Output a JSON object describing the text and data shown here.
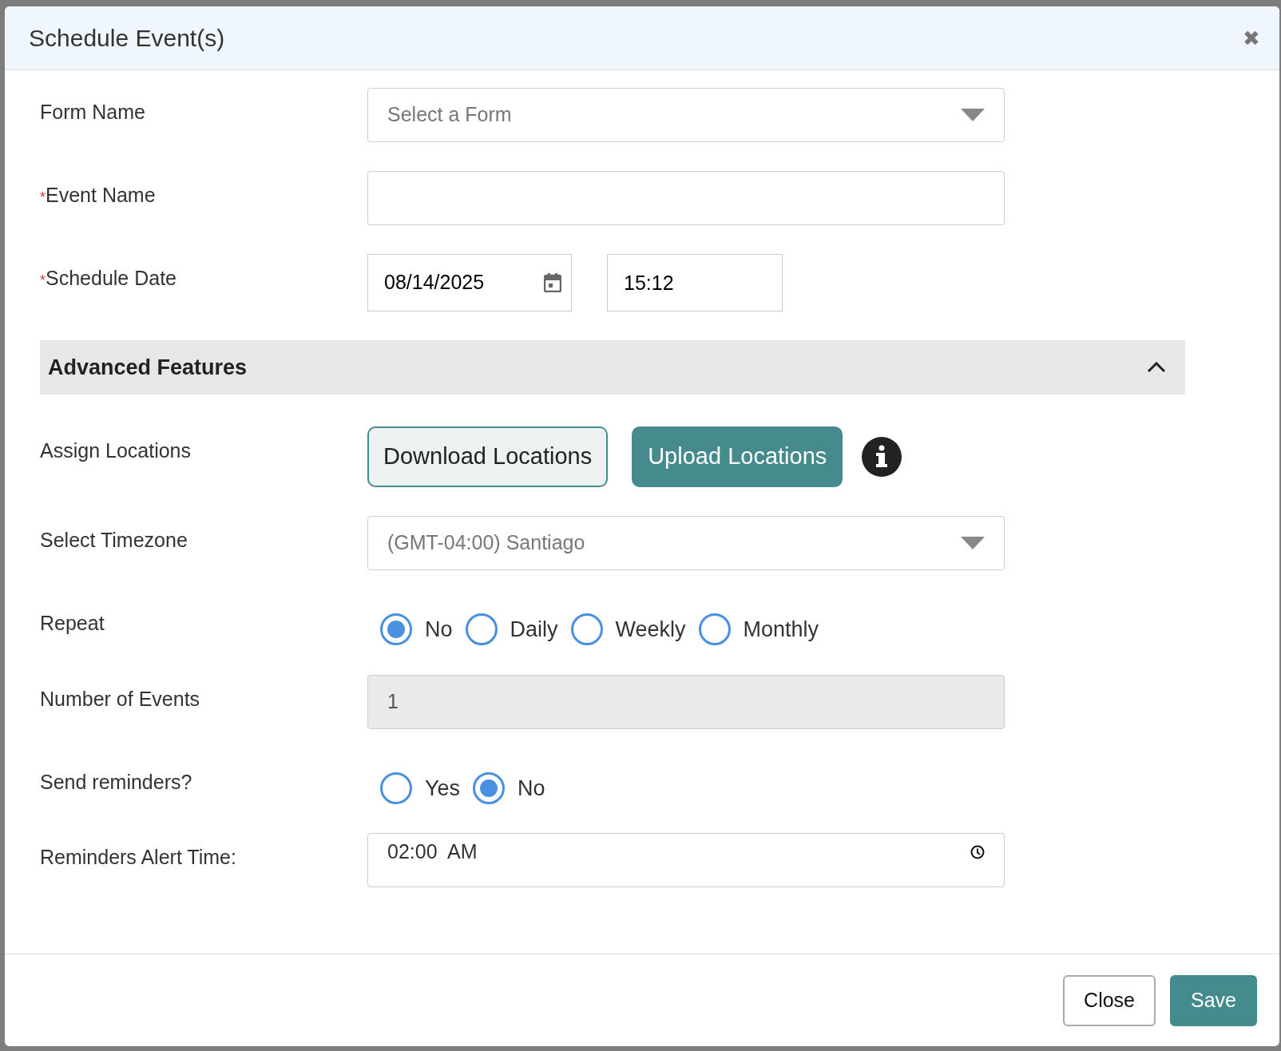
{
  "modal": {
    "title": "Schedule Event(s)",
    "close_icon": "✖"
  },
  "fields": [
    {
      "kind": "select",
      "label": "Form Name",
      "placeholder": "Select a Form"
    },
    {
      "kind": "text",
      "label": "Event Name",
      "required_mark": "*"
    },
    {
      "kind": "datetime",
      "label": "Schedule Date",
      "required_mark": "*",
      "date": "08/14/2025",
      "time": "15:12"
    }
  ],
  "advanced": {
    "title": "Advanced Features",
    "expanded": true,
    "fields": [
      {
        "kind": "buttons",
        "label": "Assign Locations",
        "buttons": [
          {
            "label": "Download Locations",
            "primary": false
          },
          {
            "label": "Upload Locations",
            "primary": true
          }
        ]
      },
      {
        "kind": "select",
        "label": "Select Timezone",
        "value": "(GMT-04:00) Santiago"
      },
      {
        "kind": "radio",
        "label": "Repeat",
        "options": [
          {
            "label": "No",
            "selected": true
          },
          {
            "label": "Daily",
            "selected": false
          },
          {
            "label": "Weekly",
            "selected": false
          },
          {
            "label": "Monthly",
            "selected": false
          }
        ]
      },
      {
        "kind": "text",
        "label": "Number of Events",
        "value": "1",
        "disabled": true
      },
      {
        "kind": "radio",
        "label": "Send reminders?",
        "options": [
          {
            "label": "Yes",
            "selected": false
          },
          {
            "label": "No",
            "selected": true
          }
        ]
      },
      {
        "kind": "time",
        "label": "Reminders Alert Time:",
        "value": "02:00  AM"
      }
    ]
  },
  "footer": {
    "buttons": [
      {
        "label": "Close",
        "primary": false
      },
      {
        "label": "Save",
        "primary": true
      }
    ]
  }
}
